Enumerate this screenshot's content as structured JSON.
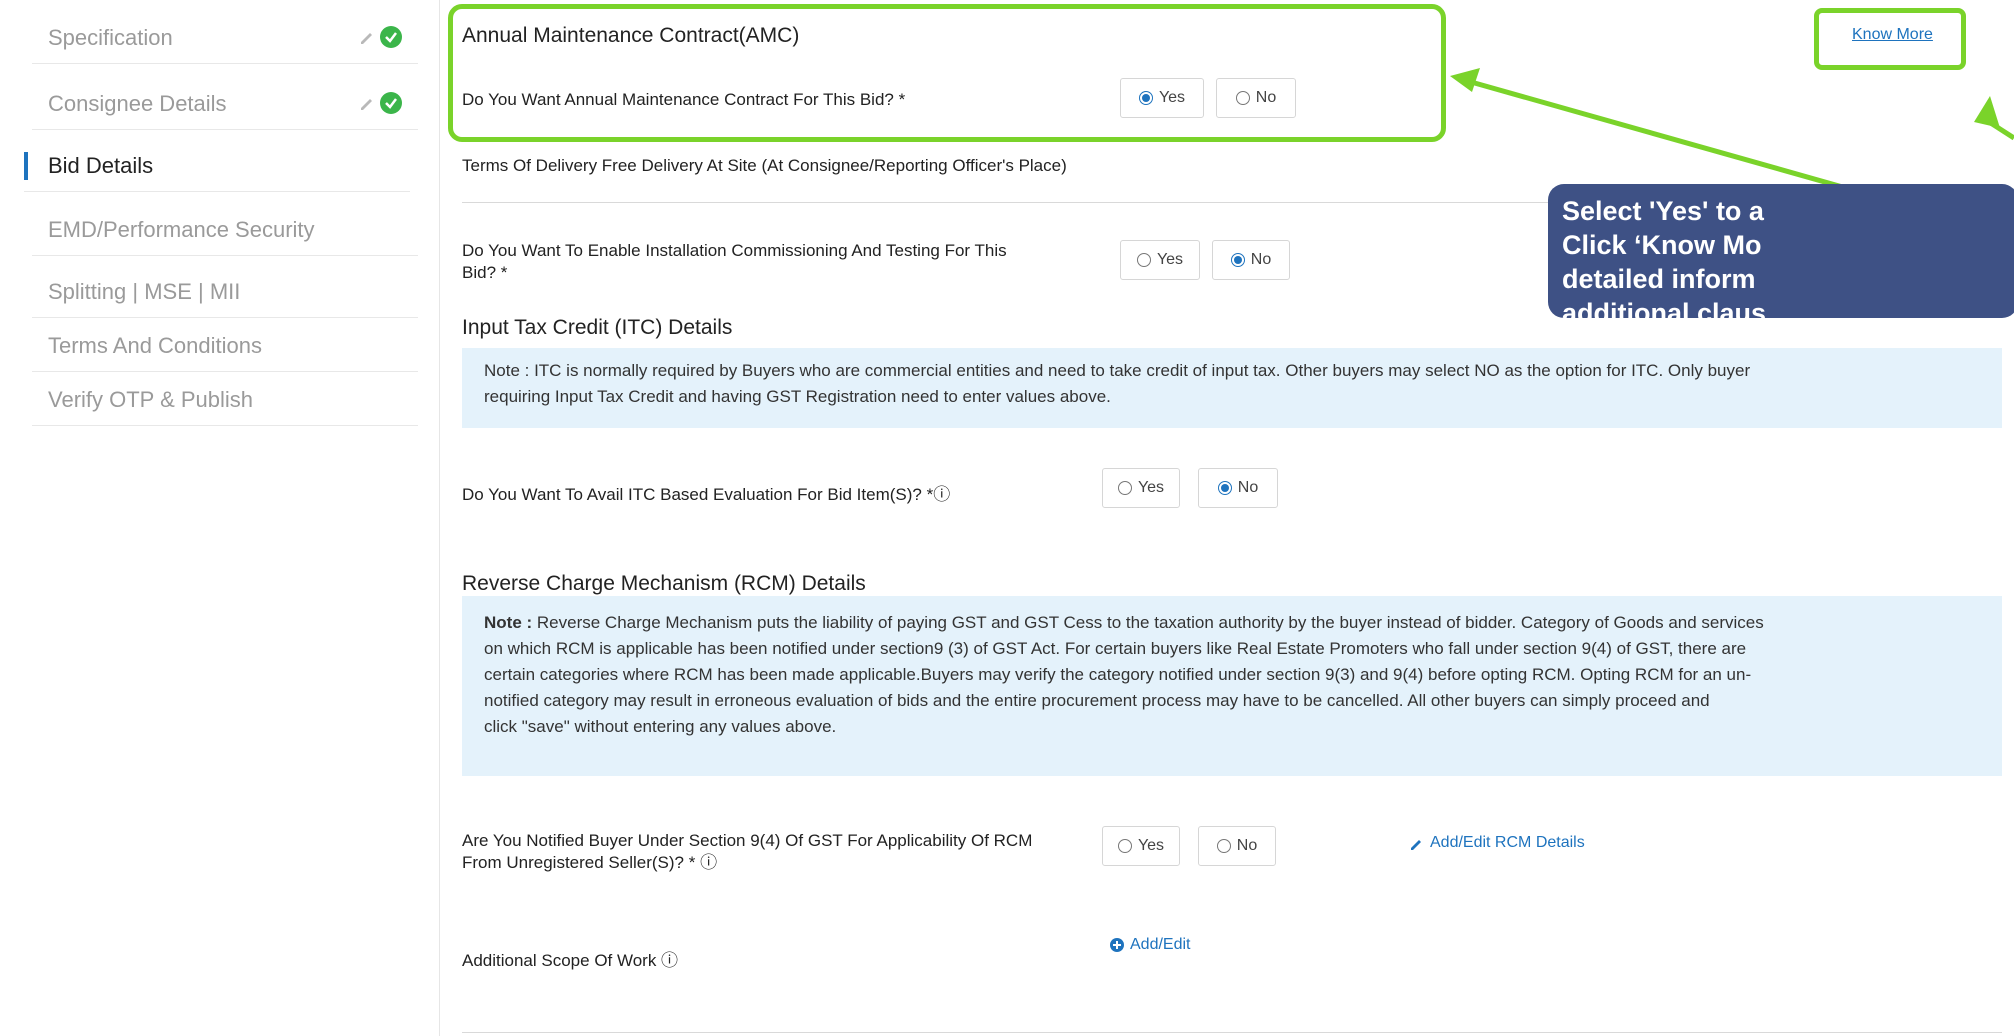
{
  "sidebar": {
    "items": [
      {
        "label": "Specification",
        "done": true
      },
      {
        "label": "Consignee Details",
        "done": true
      },
      {
        "label": "Bid Details",
        "active": true
      },
      {
        "label": "EMD/Performance Security"
      },
      {
        "label": "Splitting | MSE | MII"
      },
      {
        "label": "Terms And Conditions"
      },
      {
        "label": "Verify OTP & Publish"
      }
    ]
  },
  "amc": {
    "title": "Annual Maintenance Contract(AMC)",
    "know_more": "Know More",
    "question": "Do You Want Annual Maintenance Contract For This Bid? *",
    "yes": "Yes",
    "no": "No",
    "selected": "Yes"
  },
  "delivery": {
    "text": "Terms Of Delivery Free Delivery At Site (At Consignee/Reporting Officer's Place)"
  },
  "installation": {
    "question_line1": "Do You Want To Enable Installation Commissioning And Testing For This",
    "question_line2": "Bid? *",
    "yes": "Yes",
    "no": "No",
    "selected": "No"
  },
  "itc": {
    "title": "Input Tax Credit (ITC) Details",
    "note_line1": "Note : ITC is normally required by Buyers who are commercial entities and need to take credit of input tax. Other buyers may select NO as the option for ITC. Only buyer",
    "note_line2": "requiring Input Tax Credit and having GST Registration need to enter values above.",
    "question": "Do You Want To Avail ITC Based Evaluation For Bid Item(S)? *ⓘ",
    "yes": "Yes",
    "no": "No",
    "selected": "No"
  },
  "rcm": {
    "title": "Reverse Charge Mechanism (RCM) Details",
    "note_label": "Note :",
    "note_line1": " Reverse Charge Mechanism puts the liability of paying GST and GST Cess to the taxation authority by the buyer instead of bidder. Category of Goods and services",
    "note_line2": "on which RCM is applicable has been notified under section9 (3) of GST Act. For certain buyers like Real Estate Promoters who fall under section 9(4) of GST, there are",
    "note_line3": "certain categories where RCM has been made applicable.Buyers may verify the category notified under section 9(3) and 9(4) before opting RCM. Opting RCM for an un-",
    "note_line4": "notified category may result in erroneous evaluation of bids and the entire procurement process may have to be cancelled. All other buyers can simply proceed and",
    "note_line5": "click \"save\" without entering any values above.",
    "question_line1": "Are You Notified Buyer Under Section 9(4) Of GST For Applicability Of RCM",
    "question_line2": "From Unregistered Seller(S)? * ⓘ",
    "yes": "Yes",
    "no": "No",
    "selected": "",
    "add_edit": "Add/Edit RCM Details"
  },
  "scope": {
    "label": "Additional Scope Of Work ⓘ",
    "add_edit": "Add/Edit"
  },
  "callout": {
    "line1": "Select  'Yes' to a",
    "line2": "Click ‘Know Mo",
    "line3": "detailed inform",
    "line4": "additional claus"
  },
  "colors": {
    "accent": "#1e73be",
    "annotation_green": "#7ad32a",
    "callout_bg": "#3e5185",
    "note_bg": "#e4f2fb",
    "check_green": "#3bb54a"
  }
}
